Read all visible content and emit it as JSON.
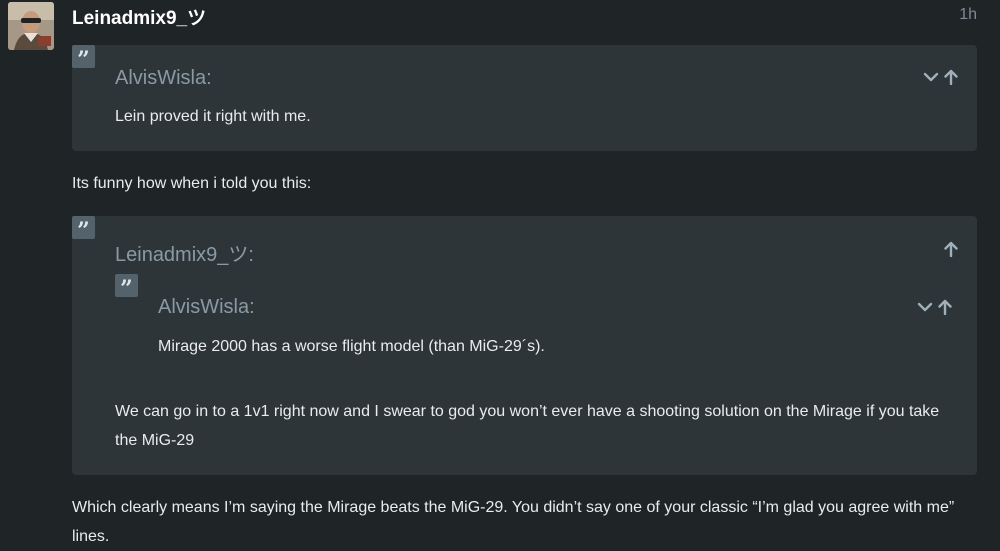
{
  "post": {
    "username": "Leinadmix9_ツ",
    "timestamp": "1h",
    "body_line": "Its funny how when i told you this:",
    "closing_text": "Which clearly means I’m saying the Mirage beats the MiG-29. You didn’t say one of your classic “I’m glad you agree with me” lines."
  },
  "quote1": {
    "author": "AlvisWisla:",
    "text": "Lein proved it right with me."
  },
  "quote2": {
    "author": "Leinadmix9_ツ:",
    "nested_quote": {
      "author": "AlvisWisla:",
      "text": "Mirage 2000 has a worse flight model (than MiG-29´s)."
    },
    "text": "We can go in to a 1v1 right now and I swear to god you won’t ever have a shooting solution on the Mirage if you take the MiG-29"
  },
  "icons": {
    "quote": "quote-icon",
    "expand": "chevron-down-icon",
    "jump": "arrow-up-icon"
  },
  "colors": {
    "background": "#1f2426",
    "quote_background": "#2d3539",
    "quote_badge": "#54636b",
    "muted_text": "#8a9aa3",
    "icon": "#9fb0b8"
  }
}
